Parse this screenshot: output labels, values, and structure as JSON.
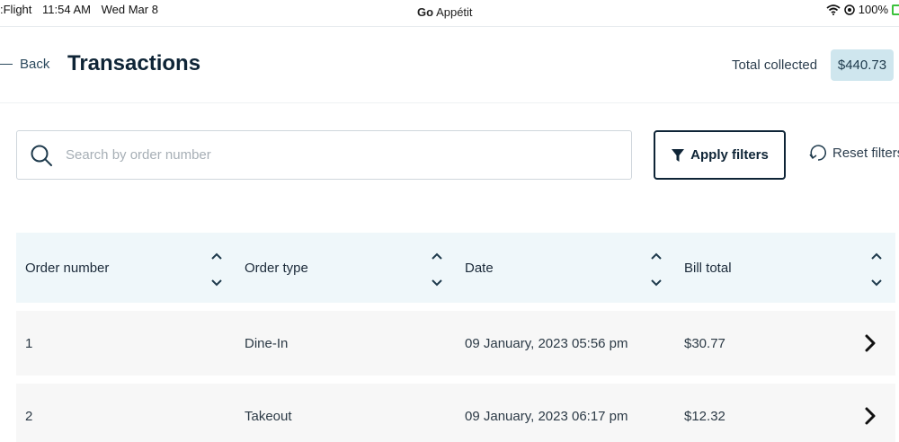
{
  "status_bar": {
    "carrier": ":Flight",
    "time": "11:54 AM",
    "date": "Wed Mar 8",
    "app_brand_bold": "Go",
    "app_brand_rest": "Appétit",
    "battery": "100%"
  },
  "header": {
    "back_label": "Back",
    "title": "Transactions",
    "total_label": "Total collected",
    "total_value": "$440.73"
  },
  "search": {
    "placeholder": "Search by order number",
    "value": ""
  },
  "filters": {
    "apply_label": "Apply filters",
    "reset_label": "Reset filters"
  },
  "table": {
    "columns": [
      "Order number",
      "Order type",
      "Date",
      "Bill total"
    ],
    "rows": [
      {
        "order_number": "1",
        "order_type": "Dine-In",
        "date": "09 January, 2023 05:56 pm",
        "bill_total": "$30.77"
      },
      {
        "order_number": "2",
        "order_type": "Takeout",
        "date": "09 January, 2023 06:17 pm",
        "bill_total": "$12.32"
      }
    ]
  },
  "colors": {
    "primary": "#0e2436",
    "header_bg": "#eff7fa",
    "badge_bg": "#cfe6ee",
    "row_bg": "#f7f7f7"
  }
}
